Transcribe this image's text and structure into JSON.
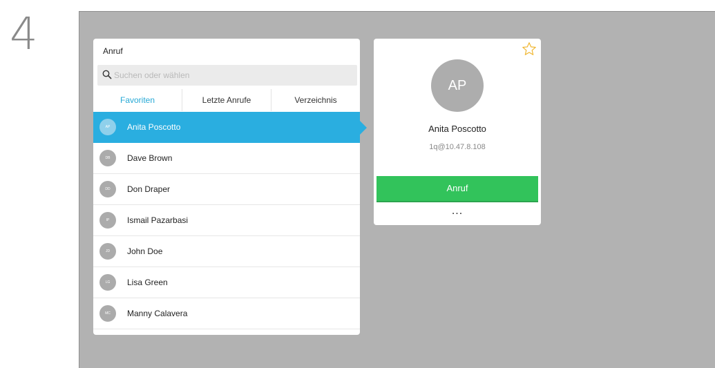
{
  "step": {
    "number": "4"
  },
  "call_panel": {
    "title": "Anruf",
    "search": {
      "placeholder": "Suchen oder wählen"
    },
    "tabs": [
      {
        "label": "Favoriten",
        "active": true
      },
      {
        "label": "Letzte Anrufe",
        "active": false
      },
      {
        "label": "Verzeichnis",
        "active": false
      }
    ],
    "contacts": [
      {
        "initials": "AP",
        "name": "Anita Poscotto",
        "selected": true
      },
      {
        "initials": "DB",
        "name": "Dave Brown",
        "selected": false
      },
      {
        "initials": "DD",
        "name": "Don Draper",
        "selected": false
      },
      {
        "initials": "IP",
        "name": "Ismail Pazarbasi",
        "selected": false
      },
      {
        "initials": "JD",
        "name": "John Doe",
        "selected": false
      },
      {
        "initials": "LG",
        "name": "Lisa Green",
        "selected": false
      },
      {
        "initials": "MC",
        "name": "Manny Calavera",
        "selected": false
      }
    ]
  },
  "detail": {
    "initials": "AP",
    "name": "Anita Poscotto",
    "address": "1q@10.47.8.108",
    "call_label": "Anruf",
    "more_label": "...",
    "favorite_icon": "star-outline-icon"
  },
  "colors": {
    "accent": "#2aaee0",
    "call_green": "#32c35b",
    "star_gold": "#f0b630",
    "screen_bg": "#b2b2b2"
  }
}
